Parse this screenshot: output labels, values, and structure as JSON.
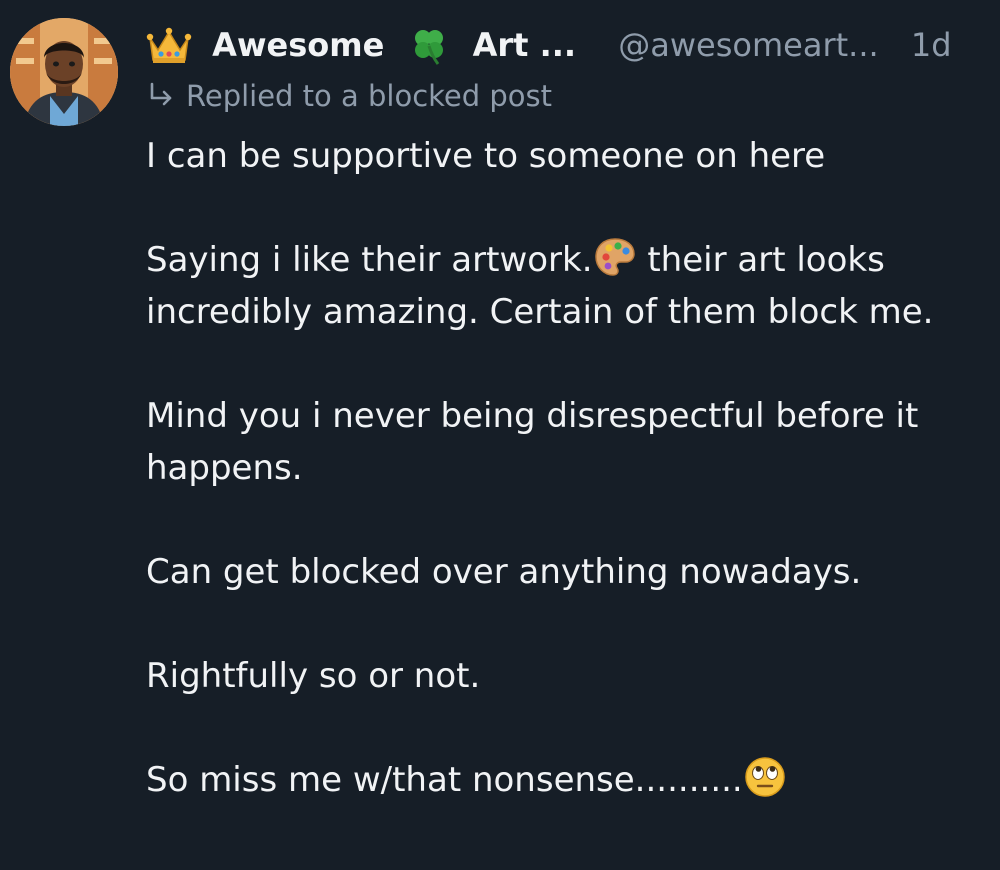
{
  "post": {
    "author": {
      "name": "Awesome",
      "name_suffix": "Art ...",
      "handle": "@awesomeart...",
      "avatar_icon": "avatar-person-icon",
      "badge_icons": [
        "crown-emoji",
        "four-leaf-clover-emoji"
      ]
    },
    "timestamp": "1d",
    "reply_context": "Replied to a blocked post",
    "paragraphs": {
      "p1": "I can be supportive to someone on here",
      "p2a": "Saying i like their artwork.",
      "p2b": " their art looks incredibly amazing. Certain of them block me.",
      "p3": "Mind you i never being disrespectful before it happens.",
      "p4": "Can get blocked over anything nowadays.",
      "p5": "Rightfully so or not.",
      "p6": "So miss me w/that nonsense.........."
    },
    "inline_emojis": [
      "artist-palette-emoji",
      "face-with-rolling-eyes-emoji"
    ]
  },
  "colors": {
    "background": "#161e27",
    "text": "#f1f3f5",
    "muted": "#8f9cab"
  }
}
